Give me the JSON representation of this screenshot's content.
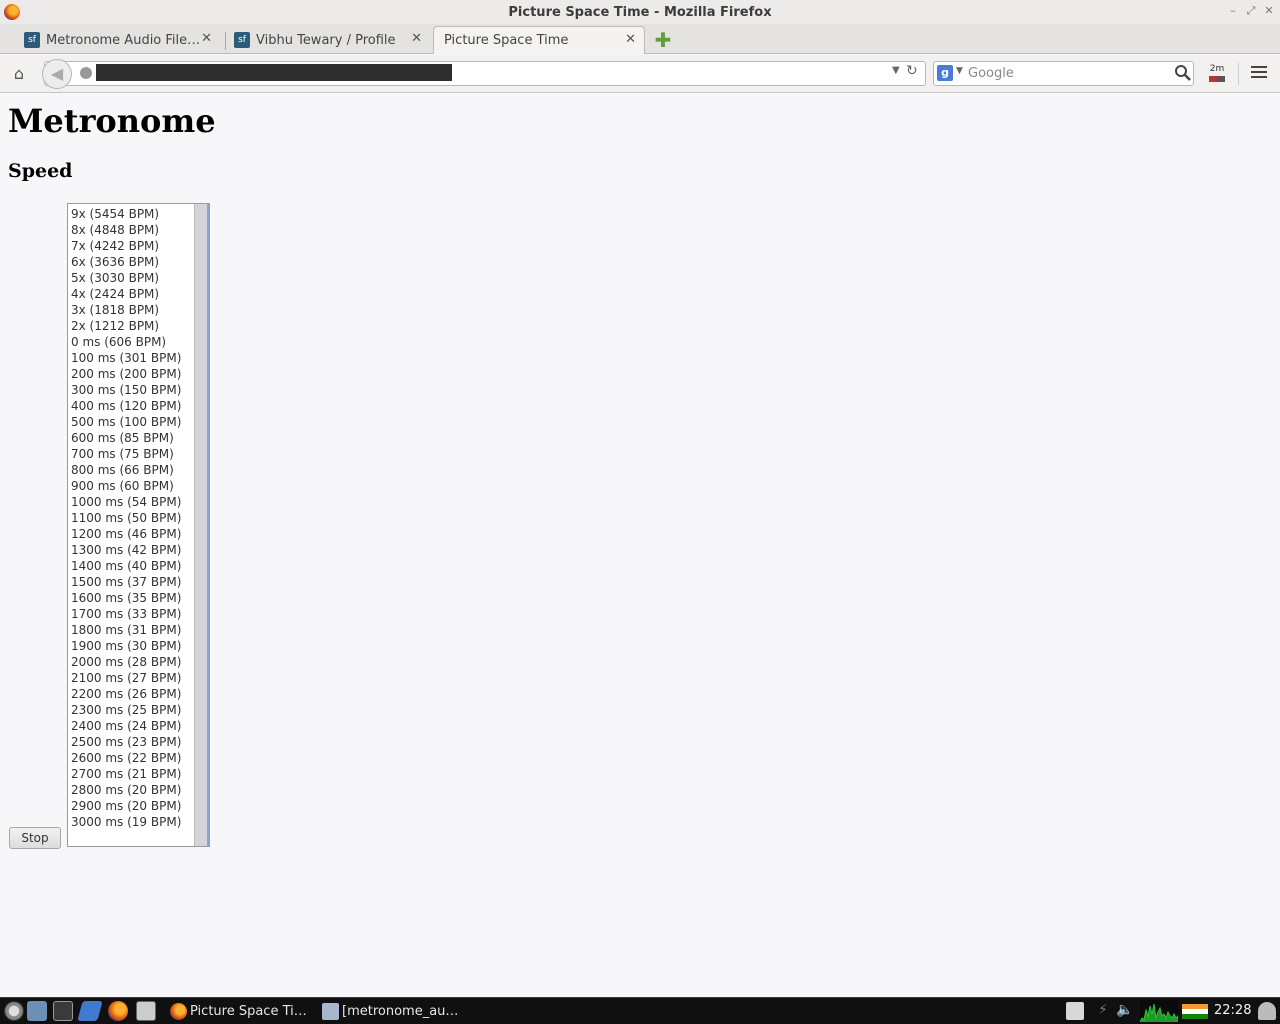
{
  "window": {
    "title": "Picture Space Time - Mozilla Firefox"
  },
  "tabs": [
    {
      "label": "Metronome Audio File…",
      "favicon": "sf"
    },
    {
      "label": "Vibhu Tewary / Profile",
      "favicon": "sf"
    },
    {
      "label": "Picture Space Time",
      "favicon": ""
    }
  ],
  "navbar": {
    "search_placeholder": "Google",
    "addon_label": "2m"
  },
  "page": {
    "heading": "Metronome",
    "subheading": "Speed",
    "stop_label": "Stop",
    "speed_options": [
      "9x (5454 BPM)",
      "8x (4848 BPM)",
      "7x (4242 BPM)",
      "6x (3636 BPM)",
      "5x (3030 BPM)",
      "4x (2424 BPM)",
      "3x (1818 BPM)",
      "2x (1212 BPM)",
      "0 ms (606 BPM)",
      "100 ms (301 BPM)",
      "200 ms (200 BPM)",
      "300 ms (150 BPM)",
      "400 ms (120 BPM)",
      "500 ms (100 BPM)",
      "600 ms (85 BPM)",
      "700 ms (75 BPM)",
      "800 ms (66 BPM)",
      "900 ms (60 BPM)",
      "1000 ms (54 BPM)",
      "1100 ms (50 BPM)",
      "1200 ms (46 BPM)",
      "1300 ms (42 BPM)",
      "1400 ms (40 BPM)",
      "1500 ms (37 BPM)",
      "1600 ms (35 BPM)",
      "1700 ms (33 BPM)",
      "1800 ms (31 BPM)",
      "1900 ms (30 BPM)",
      "2000 ms (28 BPM)",
      "2100 ms (27 BPM)",
      "2200 ms (26 BPM)",
      "2300 ms (25 BPM)",
      "2400 ms (24 BPM)",
      "2500 ms (23 BPM)",
      "2600 ms (22 BPM)",
      "2700 ms (21 BPM)",
      "2800 ms (20 BPM)",
      "2900 ms (20 BPM)",
      "3000 ms (19 BPM)"
    ]
  },
  "taskbar": {
    "tasks": [
      {
        "label": "Picture Space Ti…",
        "icon": "firefox-icon"
      },
      {
        "label": "[metronome_au…",
        "icon": "folder-icon"
      }
    ],
    "clock": "22:28"
  },
  "colors": {
    "page_bg": "#f7f6f8",
    "taskbar_bg": "#101010",
    "tab_favicon": "#2f5b7a"
  }
}
